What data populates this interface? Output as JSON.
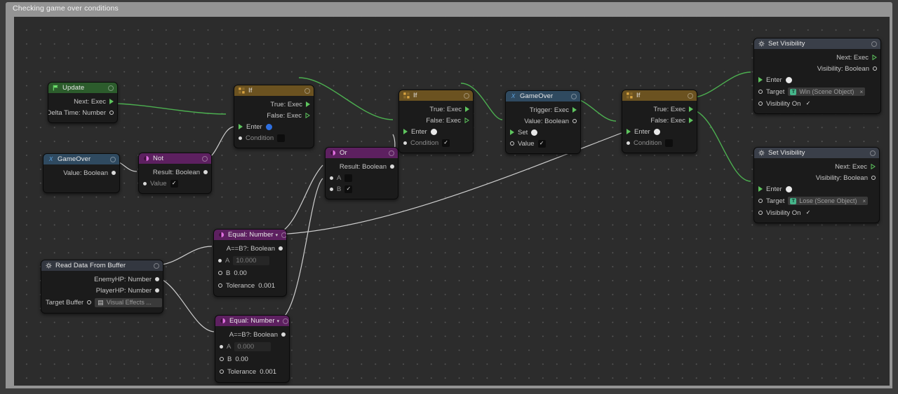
{
  "window": {
    "title": "Checking game over conditions"
  },
  "theme": {
    "canvas_bg": "#2c2c2c",
    "exec_wire": "#4caf50",
    "data_wire": "#d0d0d0",
    "header_update": "#2c5c2c",
    "header_event": "#2f4a60",
    "header_logic": "#5d2060",
    "header_if": "#6b5220",
    "header_action": "#3a3f49"
  },
  "nodes": {
    "update": {
      "title": "Update",
      "icon": "flag-icon",
      "outputs": [
        {
          "label": "Next: Exec",
          "port": "exec-filled"
        },
        {
          "label": "Delta Time: Number",
          "port": "ring"
        }
      ]
    },
    "gameover_left": {
      "title": "GameOver",
      "icon": "variable-icon",
      "outputs": [
        {
          "label": "Value: Boolean",
          "port": "dot"
        }
      ]
    },
    "not": {
      "title": "Not",
      "icon": "logic-icon",
      "outputs": [
        {
          "label": "Result: Boolean",
          "port": "dot"
        }
      ],
      "inputs": [
        {
          "label": "Value",
          "port": "dot",
          "value": "checked"
        }
      ]
    },
    "if1": {
      "title": "If",
      "icon": "branch-icon",
      "outputs": [
        {
          "label": "True: Exec",
          "port": "exec-filled"
        },
        {
          "label": "False: Exec",
          "port": "exec-hollow"
        }
      ],
      "inputs": [
        {
          "label": "Enter",
          "port": "exec-filled",
          "value": "blue-dot"
        },
        {
          "label": "Condition",
          "port": "dot",
          "value": "unchecked"
        }
      ]
    },
    "if2": {
      "title": "If",
      "icon": "branch-icon",
      "outputs": [
        {
          "label": "True: Exec",
          "port": "exec-filled"
        },
        {
          "label": "False: Exec",
          "port": "exec-hollow"
        }
      ],
      "inputs": [
        {
          "label": "Enter",
          "port": "exec-filled",
          "value": "white-dot"
        },
        {
          "label": "Condition",
          "port": "dot",
          "value": "checked"
        }
      ]
    },
    "if3": {
      "title": "If",
      "icon": "branch-icon",
      "outputs": [
        {
          "label": "True: Exec",
          "port": "exec-filled"
        },
        {
          "label": "False: Exec",
          "port": "exec-filled"
        }
      ],
      "inputs": [
        {
          "label": "Enter",
          "port": "exec-filled",
          "value": "white-dot"
        },
        {
          "label": "Condition",
          "port": "dot",
          "value": "unchecked"
        }
      ]
    },
    "or": {
      "title": "Or",
      "icon": "logic-icon",
      "outputs": [
        {
          "label": "Result: Boolean",
          "port": "dot"
        }
      ],
      "inputs": [
        {
          "label": "A",
          "port": "dot",
          "value": "unchecked"
        },
        {
          "label": "B",
          "port": "dot",
          "value": "checked"
        }
      ]
    },
    "gameover_right": {
      "title": "GameOver",
      "icon": "variable-icon",
      "outputs": [
        {
          "label": "Trigger: Exec",
          "port": "exec-filled"
        },
        {
          "label": "Value: Boolean",
          "port": "ring"
        }
      ],
      "inputs": [
        {
          "label": "Set",
          "port": "exec-filled",
          "value": "white-dot"
        },
        {
          "label": "Value",
          "port": "ring",
          "value": "checked"
        }
      ]
    },
    "read_buffer": {
      "title": "Read Data From Buffer",
      "icon": "gear-icon",
      "outputs": [
        {
          "label": "EnemyHP: Number",
          "port": "dot"
        },
        {
          "label": "PlayerHP: Number",
          "port": "dot"
        }
      ],
      "inputs": [
        {
          "label": "Target Buffer",
          "port": "ring",
          "value": "Visual Effects ..."
        }
      ]
    },
    "equal1": {
      "title": "Equal: Number",
      "icon": "math-icon",
      "caret": "▾",
      "outputs": [
        {
          "label": "A==B?: Boolean",
          "port": "dot"
        }
      ],
      "inputs": [
        {
          "label": "A",
          "port": "dot",
          "value": "10.000",
          "style": "ghost"
        },
        {
          "label": "B",
          "port": "ring",
          "value": "0.00",
          "style": "plain"
        },
        {
          "label": "Tolerance",
          "port": "ring",
          "value": "0.001",
          "style": "plain"
        }
      ]
    },
    "equal2": {
      "title": "Equal: Number",
      "icon": "math-icon",
      "caret": "▾",
      "outputs": [
        {
          "label": "A==B?: Boolean",
          "port": "dot"
        }
      ],
      "inputs": [
        {
          "label": "A",
          "port": "dot",
          "value": "0.000",
          "style": "ghost"
        },
        {
          "label": "B",
          "port": "ring",
          "value": "0.00",
          "style": "plain"
        },
        {
          "label": "Tolerance",
          "port": "ring",
          "value": "0.001",
          "style": "plain"
        }
      ]
    },
    "setvis_win": {
      "title": "Set Visibility",
      "icon": "gear-icon",
      "outputs": [
        {
          "label": "Next: Exec",
          "port": "exec-hollow"
        },
        {
          "label": "Visibility: Boolean",
          "port": "ring"
        }
      ],
      "inputs": [
        {
          "label": "Enter",
          "port": "exec-filled",
          "value": "white-dot"
        },
        {
          "label": "Target",
          "port": "ring",
          "value": "Win (Scene Object)",
          "badge": "T",
          "clear": "×"
        },
        {
          "label": "Visibility On",
          "port": "ring",
          "value": "checked"
        }
      ]
    },
    "setvis_lose": {
      "title": "Set Visibility",
      "icon": "gear-icon",
      "outputs": [
        {
          "label": "Next: Exec",
          "port": "exec-hollow"
        },
        {
          "label": "Visibility: Boolean",
          "port": "ring"
        }
      ],
      "inputs": [
        {
          "label": "Enter",
          "port": "exec-filled",
          "value": "white-dot"
        },
        {
          "label": "Target",
          "port": "ring",
          "value": "Lose (Scene Object)",
          "badge": "T",
          "clear": "×"
        },
        {
          "label": "Visibility On",
          "port": "ring",
          "value": "checked"
        }
      ]
    }
  }
}
